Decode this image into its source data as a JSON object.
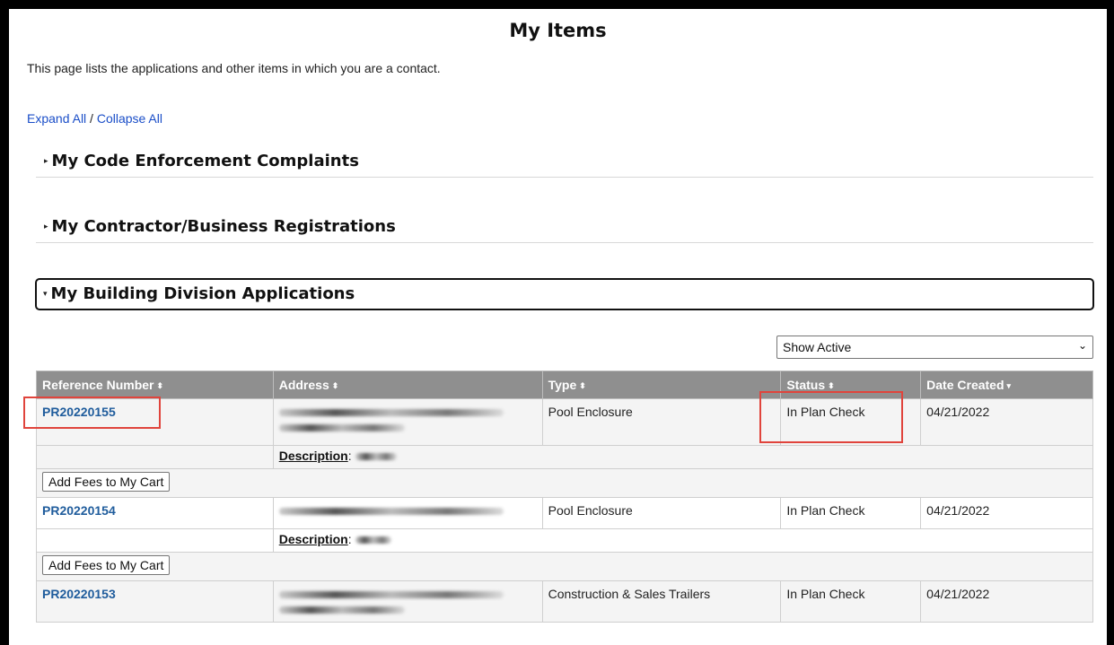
{
  "page": {
    "title": "My Items",
    "intro": "This page lists the applications and other items in which you are a contact."
  },
  "controls": {
    "expand_all": "Expand All",
    "separator": " / ",
    "collapse_all": "Collapse All"
  },
  "sections": [
    {
      "label": "My Code Enforcement Complaints",
      "expanded": false,
      "caret": "▸"
    },
    {
      "label": "My Contractor/Business Registrations",
      "expanded": false,
      "caret": "▸"
    },
    {
      "label": "My Building Division Applications",
      "expanded": true,
      "caret": "▾"
    }
  ],
  "filter": {
    "selected": "Show Active"
  },
  "table": {
    "headers": [
      {
        "label": "Reference Number",
        "sort": "⬍"
      },
      {
        "label": "Address",
        "sort": "⬍"
      },
      {
        "label": "Type",
        "sort": "⬍"
      },
      {
        "label": "Status",
        "sort": "⬍"
      },
      {
        "label": "Date Created",
        "sort": "▾"
      }
    ],
    "description_label": "Description",
    "cart_button": "Add Fees to My Cart",
    "rows": [
      {
        "ref": "PR20220155",
        "type": "Pool Enclosure",
        "status": "In Plan Check",
        "date": "04/21/2022"
      },
      {
        "ref": "PR20220154",
        "type": "Pool Enclosure",
        "status": "In Plan Check",
        "date": "04/21/2022"
      },
      {
        "ref": "PR20220153",
        "type": "Construction & Sales Trailers",
        "status": "In Plan Check",
        "date": "04/21/2022"
      }
    ]
  },
  "colors": {
    "link": "#1a4ec8",
    "ref_link": "#1f5c9c",
    "header_bg": "#8f8f8f",
    "highlight": "#e0443c"
  }
}
